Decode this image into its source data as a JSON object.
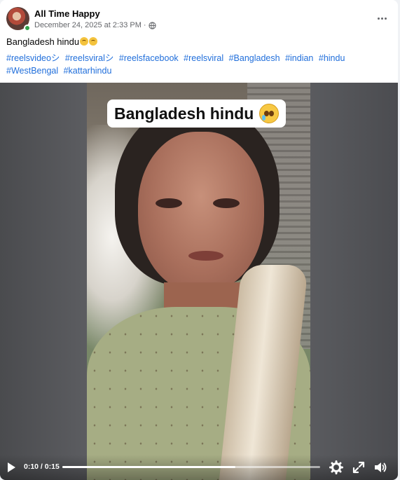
{
  "post": {
    "author": "All Time Happy",
    "timestamp": "December 24, 2025 at 2:33 PM",
    "separator": "·",
    "privacy_icon": "globe-icon",
    "more_icon": "more-options-icon",
    "caption": "Bangladesh hindu",
    "caption_emoji": "teary-face-emoji",
    "hashtags": [
      "#reelsvideoシ",
      "#reelsviralシ",
      "#reelsfacebook",
      "#reelsviral",
      "#Bangladesh",
      "#indian",
      "#hindu",
      "#WestBengal",
      "#kattarhindu"
    ]
  },
  "video": {
    "overlay_text": "Bangladesh hindu",
    "overlay_emoji": "teary-face-emoji",
    "controls": {
      "play_icon": "play-icon",
      "current_time": "0:10",
      "duration": "0:15",
      "progress": 0.67,
      "settings_icon": "gear-icon",
      "fullscreen_icon": "fullscreen-icon",
      "volume_icon": "volume-icon"
    }
  },
  "colors": {
    "link": "#216fdb",
    "online": "#31a24c",
    "meta_text": "#65676b"
  }
}
